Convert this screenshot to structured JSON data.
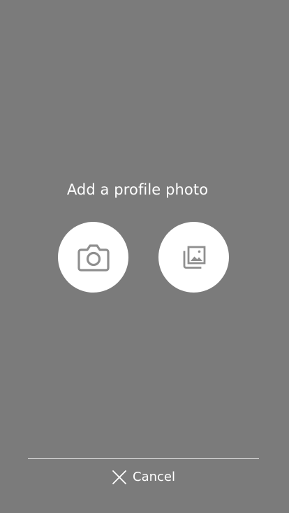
{
  "screen": {
    "title": "Add a profile photo"
  },
  "options": [
    {
      "name": "take-photo",
      "icon": "camera-icon"
    },
    {
      "name": "choose-from-gallery",
      "icon": "photo-gallery-icon"
    }
  ],
  "footer": {
    "cancel_label": "Cancel",
    "cancel_icon": "close-icon"
  },
  "colors": {
    "background": "#7b7b7b",
    "button_fill": "#ffffff",
    "icon": "#8f8f8f",
    "text": "#ffffff",
    "divider": "#e8e8e8"
  }
}
